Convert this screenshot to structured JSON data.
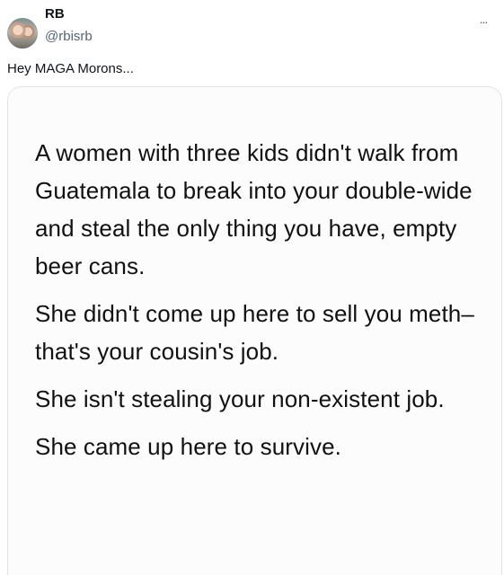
{
  "post": {
    "author": {
      "display_name": "RB",
      "handle": "@rbisrb",
      "avatar_icon": "profile-avatar"
    },
    "more_label": "...",
    "text": "Hey MAGA Morons...",
    "media": {
      "paragraphs": [
        "A women with three kids didn't walk from Guatemala to break into your double-wide and steal the only thing you have, empty beer cans.",
        "She didn't come up here to sell you meth–that's your cousin's job.",
        "She isn't stealing your non-existent job.",
        "She came up here to survive."
      ]
    }
  },
  "colors": {
    "text_primary": "#0f1419",
    "text_secondary": "#536471",
    "media_border": "#dfe6ea",
    "media_background": "#fcfcfc"
  }
}
